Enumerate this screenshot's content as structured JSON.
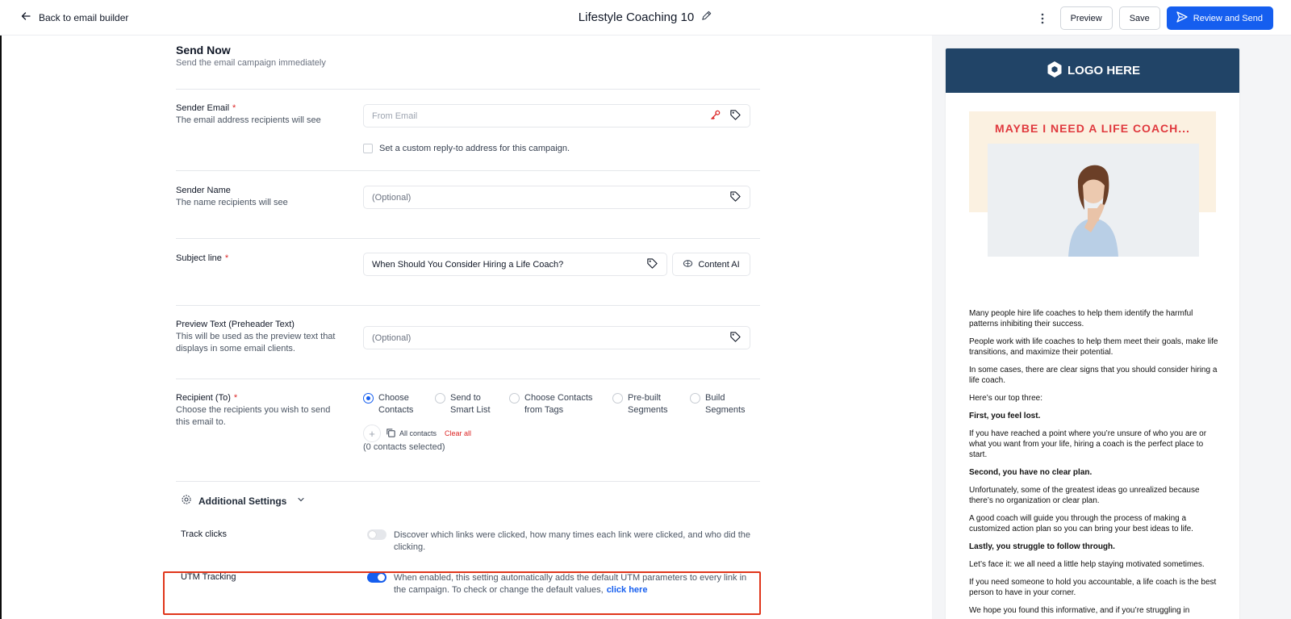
{
  "topbar": {
    "back_label": "Back to email builder",
    "title": "Lifestyle Coaching 10",
    "preview_label": "Preview",
    "save_label": "Save",
    "send_label": "Review and Send"
  },
  "send_now": {
    "title": "Send Now",
    "subtitle": "Send the email campaign immediately"
  },
  "sender_email": {
    "label": "Sender Email",
    "required": "*",
    "desc": "The email address recipients will see",
    "placeholder": "From Email",
    "reply_to_label": "Set a custom reply-to address for this campaign."
  },
  "sender_name": {
    "label": "Sender Name",
    "desc": "The name recipients will see",
    "placeholder": "(Optional)"
  },
  "subject": {
    "label": "Subject line",
    "required": "*",
    "value": "When Should You Consider Hiring a Life Coach?",
    "content_ai_label": "Content AI"
  },
  "preview_text": {
    "label": "Preview Text (Preheader Text)",
    "desc": "This will be used as the preview text that displays in some email clients.",
    "placeholder": "(Optional)"
  },
  "recipient": {
    "label": "Recipient (To)",
    "required": "*",
    "desc": "Choose the recipients you wish to send this email to.",
    "options": [
      {
        "line1": "Choose",
        "line2": "Contacts",
        "selected": true
      },
      {
        "line1": "Send to",
        "line2": "Smart List",
        "selected": false
      },
      {
        "line1": "Choose Contacts",
        "line2": "from Tags",
        "selected": false
      },
      {
        "line1": "Pre-built",
        "line2": "Segments",
        "selected": false
      },
      {
        "line1": "Build",
        "line2": "Segments",
        "selected": false
      }
    ],
    "all_contacts_label": "All contacts",
    "clear_all_label": "Clear all",
    "selected_count": "(0 contacts selected)"
  },
  "additional_settings": {
    "title": "Additional Settings",
    "track_clicks": {
      "label": "Track clicks",
      "enabled": false,
      "desc": "Discover which links were clicked, how many times each link were clicked, and who did the clicking."
    },
    "utm_tracking": {
      "label": "UTM Tracking",
      "enabled": true,
      "desc": "When enabled, this setting automatically adds the default UTM parameters to every link in the campaign. To check or change the default values,",
      "link_label": "click here"
    }
  },
  "email_preview": {
    "logo_text": "LOGO HERE",
    "hero_title": "MAYBE I NEED A LIFE COACH...",
    "paragraphs": [
      {
        "text": "Many people hire life coaches to help them identify the harmful patterns inhibiting their success.",
        "bold": false
      },
      {
        "text": "People work with life coaches to help them meet their goals, make life transitions, and maximize their potential.",
        "bold": false
      },
      {
        "text": "In some cases, there are clear signs that you should consider hiring a life coach.",
        "bold": false
      },
      {
        "text": "Here’s our top three:",
        "bold": false
      },
      {
        "text": "First, you feel lost.",
        "bold": true
      },
      {
        "text": "If you have reached a point where you’re unsure of who you are or what you want from your life, hiring a coach is the perfect place to start.",
        "bold": false
      },
      {
        "text": "Second, you have no clear plan.",
        "bold": true
      },
      {
        "text": "Unfortunately, some of the greatest ideas go unrealized because there’s no organization or clear plan.",
        "bold": false
      },
      {
        "text": "A good coach will guide you through the process of making a customized action plan so you can bring your best ideas to life.",
        "bold": false
      },
      {
        "text": "Lastly, you struggle to follow through.",
        "bold": true
      },
      {
        "text": "Let’s face it: we all need a little help staying motivated sometimes.",
        "bold": false
      },
      {
        "text": "If you need someone to hold you accountable, a life coach is the best person to have in your corner.",
        "bold": false
      },
      {
        "text": "We hope you found this informative, and if you’re struggling in",
        "bold": false
      }
    ]
  },
  "colors": {
    "primary": "#155eef",
    "required": "#dc2626",
    "email_header": "#214467",
    "hero_bg": "#fbf1e1",
    "hero_title": "#e0393e",
    "highlight_box": "#e0361b"
  }
}
